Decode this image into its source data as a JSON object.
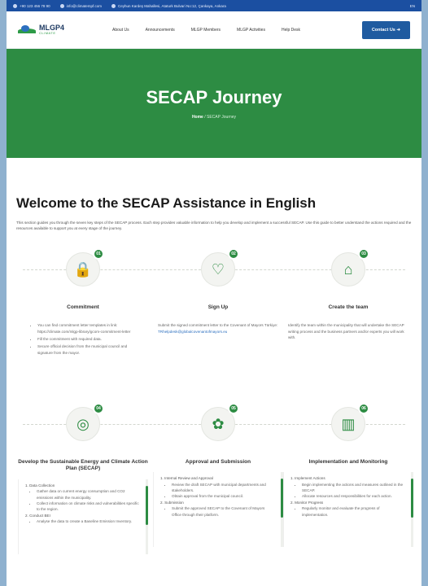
{
  "topbar": {
    "phone": "+90 123 456 78 90",
    "email": "info@climatempf.com",
    "address": "Ceyhun Kardeş Mahallesi, Ataturk Bulvari No:12, Çankaya, Ankara",
    "language": "EN"
  },
  "nav": {
    "logo_main": "MLGP4",
    "logo_sub": "CLIMATE",
    "items": [
      "About Us",
      "Announcements",
      "MLGP Members",
      "MLGP Activities",
      "Help Desk"
    ],
    "contact_label": "Contact Us ➜"
  },
  "hero": {
    "title": "SECAP Journey",
    "breadcrumb_home": "Home",
    "breadcrumb_sep": " / ",
    "breadcrumb_current": "SECAP Journey"
  },
  "intro": {
    "heading": "Welcome to the SECAP Assistance in English",
    "text": "This section guides you through the seven key steps of the SECAP process. Each step provides valuable information to help you develop and implement a successful SECAP. Use this guide to better understand the actions required and the resources available to support you at every stage of the journey."
  },
  "steps": [
    {
      "number": "01",
      "icon": "document-lock-icon",
      "glyph": "🔒",
      "title": "Commitment",
      "bullets": [
        "You can find commitment letter templates in link: https://climate.com/mlgp-library/gcom-commitment-letter",
        "Fill the commitment with required data.",
        "Secure official decision from the municipal council and signature from the mayor."
      ]
    },
    {
      "number": "02",
      "icon": "handshake-icon",
      "glyph": "♡",
      "title": "Sign Up",
      "text": "Submit the signed commitment letter to the Covenant of Mayors Türkiye:",
      "link": "TRhelpdesk@globalcovenantofmayors.eu"
    },
    {
      "number": "03",
      "icon": "team-house-icon",
      "glyph": "⌂",
      "title": "Create the team",
      "text": "Identify the team within the municipality that will undertake the SECAP writing process and the business partners and/or experts you will work with."
    },
    {
      "number": "04",
      "icon": "globe-icon",
      "glyph": "◎",
      "title": "Develop the Sustainable Energy and Climate Action Plan (SECAP)",
      "sections": [
        {
          "heading": "1. Data Collection",
          "bullets": [
            "Gather data on current energy consumption and CO2 emissions within the municipality.",
            "Collect information on climate risks and vulnerabilities specific to the region."
          ]
        },
        {
          "heading": "2. Conduct BEI",
          "bullets": [
            "Analyse the data to create a Baseline Emission Inventory."
          ]
        }
      ]
    },
    {
      "number": "05",
      "icon": "approval-badge-icon",
      "glyph": "✿",
      "title": "Approval and Submission",
      "sections": [
        {
          "heading": "1. Internal Review and Approval",
          "bullets": [
            "Review the draft SECAP with municipal departments and stakeholders.",
            "Obtain approval from the municipal council."
          ]
        },
        {
          "heading": "2. Submission",
          "bullets": [
            "Submit the approved SECAP to the Covenant of Mayors Office through their platform."
          ]
        }
      ]
    },
    {
      "number": "06",
      "icon": "factory-icon",
      "glyph": "▥",
      "title": "Implementation and Monitoring",
      "sections": [
        {
          "heading": "1. Implement Actions",
          "bullets": [
            "Begin implementing the actions and measures outlined in the SECAP.",
            "Allocate resources and responsibilities for each action."
          ]
        },
        {
          "heading": "2. Monitor Progress",
          "bullets": [
            "Regularly monitor and evaluate the progress of implementation."
          ]
        }
      ]
    }
  ]
}
